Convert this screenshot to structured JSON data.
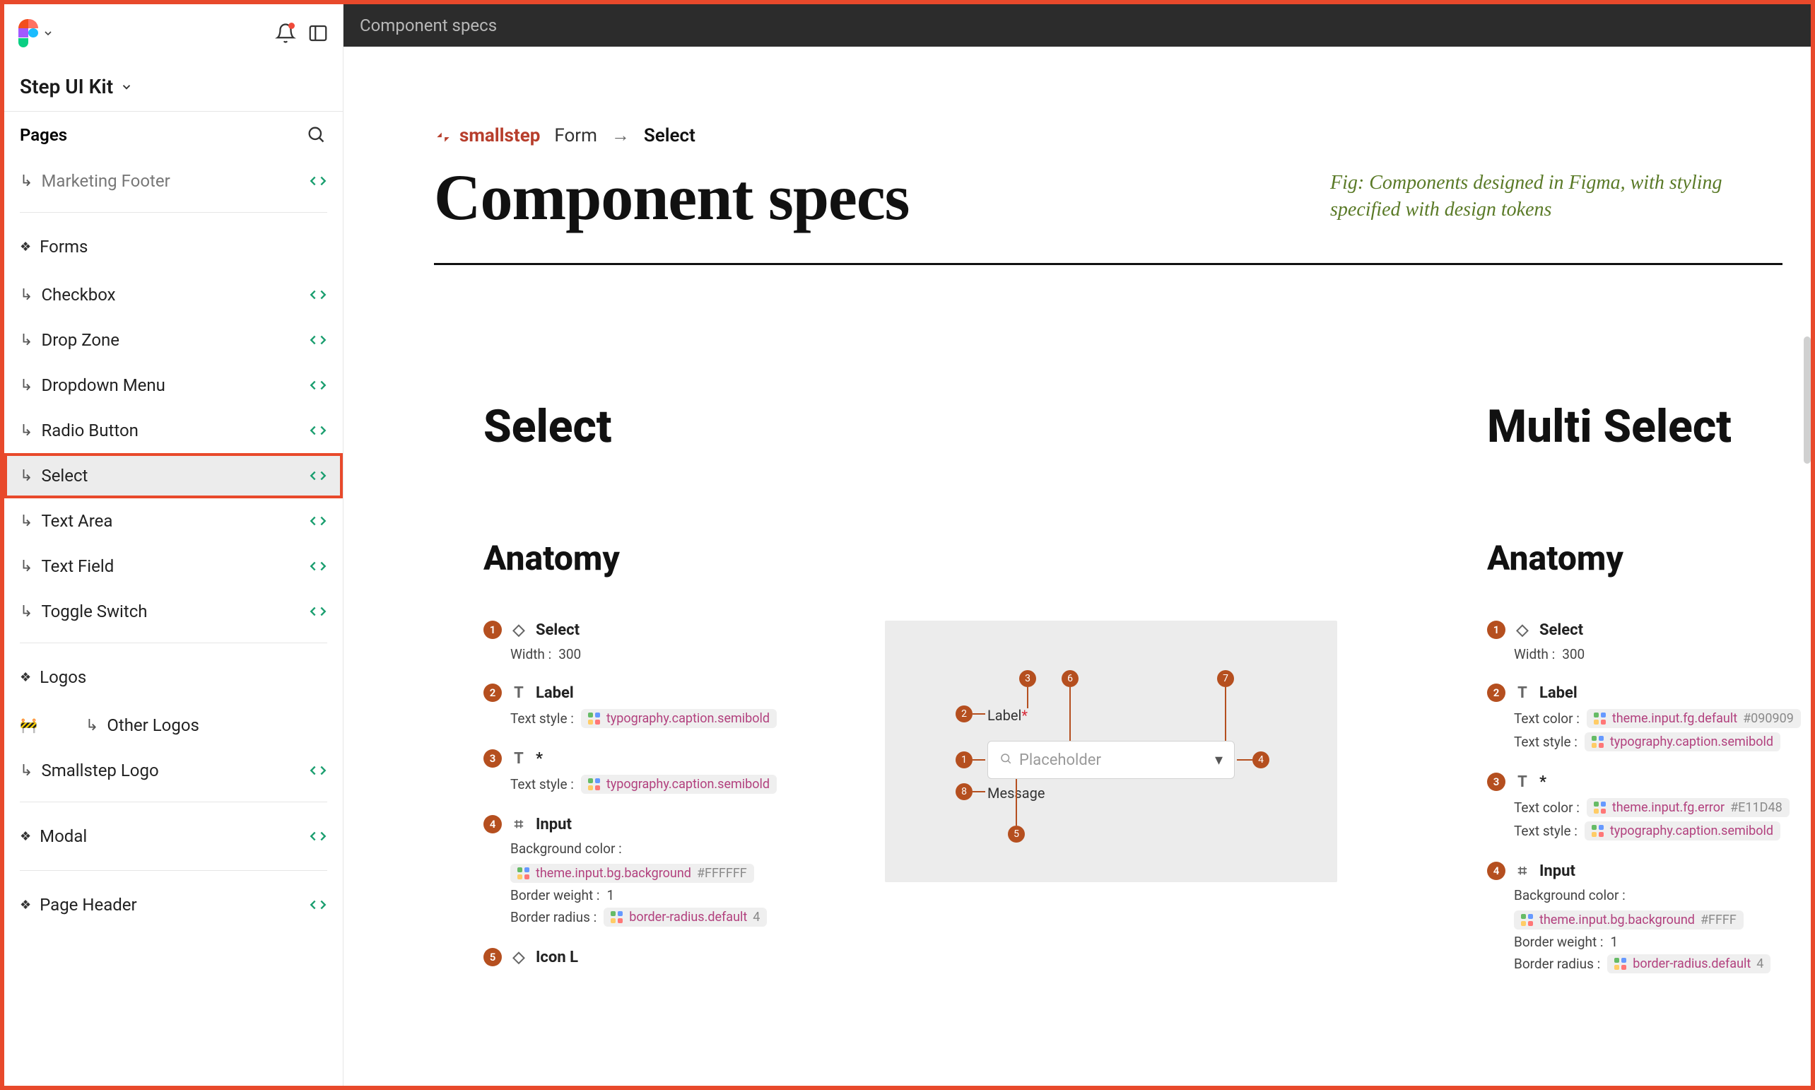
{
  "topbar": {
    "tab_label": "Component specs"
  },
  "sidebar": {
    "file_name": "Step UI Kit",
    "pages_header": "Pages",
    "items": [
      {
        "type": "page",
        "label": "Marketing Footer",
        "dev": true,
        "faded": true
      },
      {
        "type": "divider"
      },
      {
        "type": "section",
        "label": "Forms"
      },
      {
        "type": "page",
        "label": "Checkbox",
        "dev": true
      },
      {
        "type": "page",
        "label": "Drop Zone",
        "dev": true
      },
      {
        "type": "page",
        "label": "Dropdown Menu",
        "dev": true
      },
      {
        "type": "page",
        "label": "Radio Button",
        "dev": true
      },
      {
        "type": "page",
        "label": "Select",
        "dev": true,
        "selected": true,
        "highlighted": true
      },
      {
        "type": "page",
        "label": "Text Area",
        "dev": true
      },
      {
        "type": "page",
        "label": "Text Field",
        "dev": true
      },
      {
        "type": "page",
        "label": "Toggle Switch",
        "dev": true
      },
      {
        "type": "divider"
      },
      {
        "type": "section",
        "label": "Logos"
      },
      {
        "type": "page",
        "label": "Other Logos",
        "wip": true,
        "indent": true
      },
      {
        "type": "page",
        "label": "Smallstep Logo",
        "dev": true
      },
      {
        "type": "divider"
      },
      {
        "type": "section",
        "label": "Modal",
        "dev": true
      },
      {
        "type": "divider"
      },
      {
        "type": "section",
        "label": "Page Header",
        "dev": true
      }
    ]
  },
  "breadcrumb": {
    "brand": "smallstep",
    "part1": "Form",
    "part2": "Select"
  },
  "hero": {
    "title": "Component specs"
  },
  "caption": "Fig: Components designed in Figma, with styling specified with design tokens",
  "scrollbar": true,
  "left_spec": {
    "title": "Select",
    "section": "Anatomy",
    "items": [
      {
        "n": 1,
        "icon": "diamond",
        "name": "Select",
        "props": [
          {
            "label": "Width :",
            "value": "300"
          }
        ]
      },
      {
        "n": 2,
        "icon": "T",
        "name": "Label",
        "props": [
          {
            "label": "Text style :",
            "token": "typography.caption.semibold"
          }
        ]
      },
      {
        "n": 3,
        "icon": "T",
        "name": "*",
        "props": [
          {
            "label": "Text style :",
            "token": "typography.caption.semibold"
          }
        ]
      },
      {
        "n": 4,
        "icon": "frame",
        "name": "Input",
        "props": [
          {
            "label": "Background color :",
            "token": "theme.input.bg.background",
            "hex": "#FFFFFF"
          },
          {
            "label": "Border weight :",
            "value": "1"
          },
          {
            "label": "Border radius :",
            "token": "border-radius.default",
            "hex": "4"
          }
        ]
      },
      {
        "n": 5,
        "icon": "diamond",
        "name": "Icon L"
      }
    ],
    "preview": {
      "label_text": "Label",
      "asterisk": "*",
      "placeholder": "Placeholder",
      "message": "Message",
      "pins": [
        1,
        2,
        3,
        4,
        5,
        6,
        7,
        8
      ]
    }
  },
  "right_spec": {
    "title": "Multi Select",
    "section": "Anatomy",
    "items": [
      {
        "n": 1,
        "icon": "diamond",
        "name": "Select",
        "props": [
          {
            "label": "Width :",
            "value": "300"
          }
        ]
      },
      {
        "n": 2,
        "icon": "T",
        "name": "Label",
        "props": [
          {
            "label": "Text color :",
            "token": "theme.input.fg.default",
            "hex": "#090909"
          },
          {
            "label": "Text style :",
            "token": "typography.caption.semibold"
          }
        ]
      },
      {
        "n": 3,
        "icon": "T",
        "name": "*",
        "props": [
          {
            "label": "Text color :",
            "token": "theme.input.fg.error",
            "hex": "#E11D48"
          },
          {
            "label": "Text style :",
            "token": "typography.caption.semibold"
          }
        ]
      },
      {
        "n": 4,
        "icon": "frame",
        "name": "Input",
        "props": [
          {
            "label": "Background color :",
            "token": "theme.input.bg.background",
            "hex": "#FFFF"
          },
          {
            "label": "Border weight :",
            "value": "1"
          },
          {
            "label": "Border radius :",
            "token": "border-radius.default",
            "hex": "4"
          }
        ]
      }
    ]
  }
}
